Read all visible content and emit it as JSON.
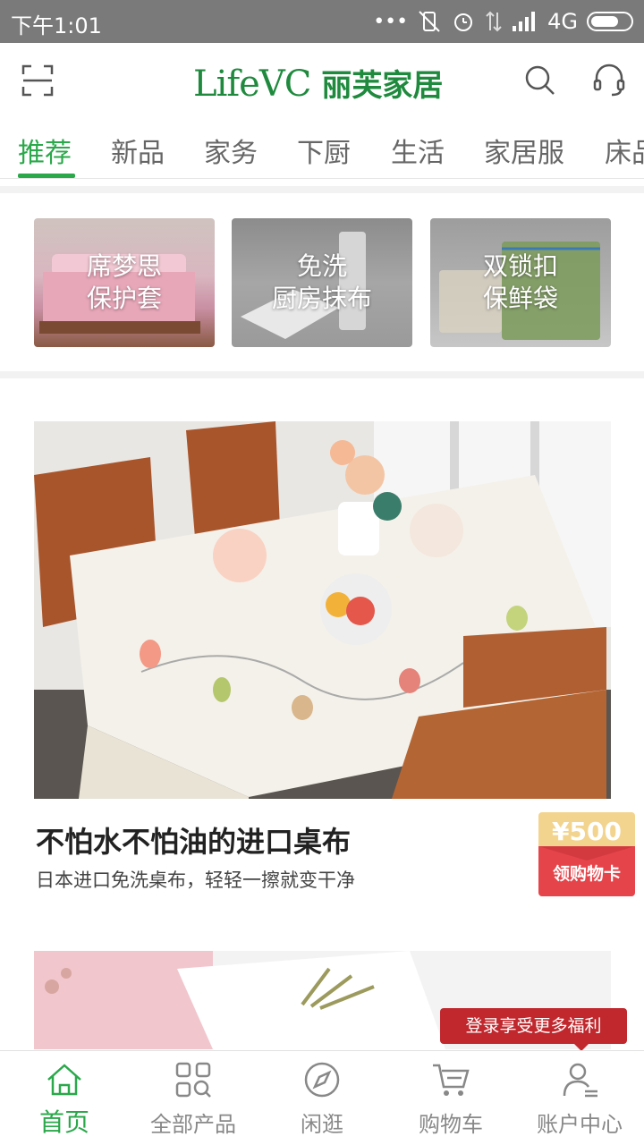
{
  "status_bar": {
    "time": "下午1:01",
    "network": "4G"
  },
  "header": {
    "logo_en": "LifeVC",
    "logo_cn": "丽芙家居",
    "brand_color": "#1f8a3e"
  },
  "tabs": [
    {
      "label": "推荐",
      "active": true
    },
    {
      "label": "新品"
    },
    {
      "label": "家务"
    },
    {
      "label": "下厨"
    },
    {
      "label": "生活"
    },
    {
      "label": "家居服"
    },
    {
      "label": "床品"
    }
  ],
  "categories": [
    {
      "label": "席梦思\n保护套"
    },
    {
      "label": "免洗\n厨房抹布"
    },
    {
      "label": "双锁扣\n保鲜袋"
    }
  ],
  "featured": {
    "title": "不怕水不怕油的进口桌布",
    "subtitle": "日本进口免洗桌布，轻轻一擦就变干净"
  },
  "coupon": {
    "amount": "¥500",
    "label": "领购物卡"
  },
  "login_tip": "登录享受更多福利",
  "bottom_nav": [
    {
      "label": "首页",
      "icon": "home-icon",
      "active": true
    },
    {
      "label": "全部产品",
      "icon": "grid-search-icon"
    },
    {
      "label": "闲逛",
      "icon": "compass-icon"
    },
    {
      "label": "购物车",
      "icon": "cart-icon"
    },
    {
      "label": "账户中心",
      "icon": "user-icon"
    }
  ],
  "accent_color": "#2aa84a"
}
